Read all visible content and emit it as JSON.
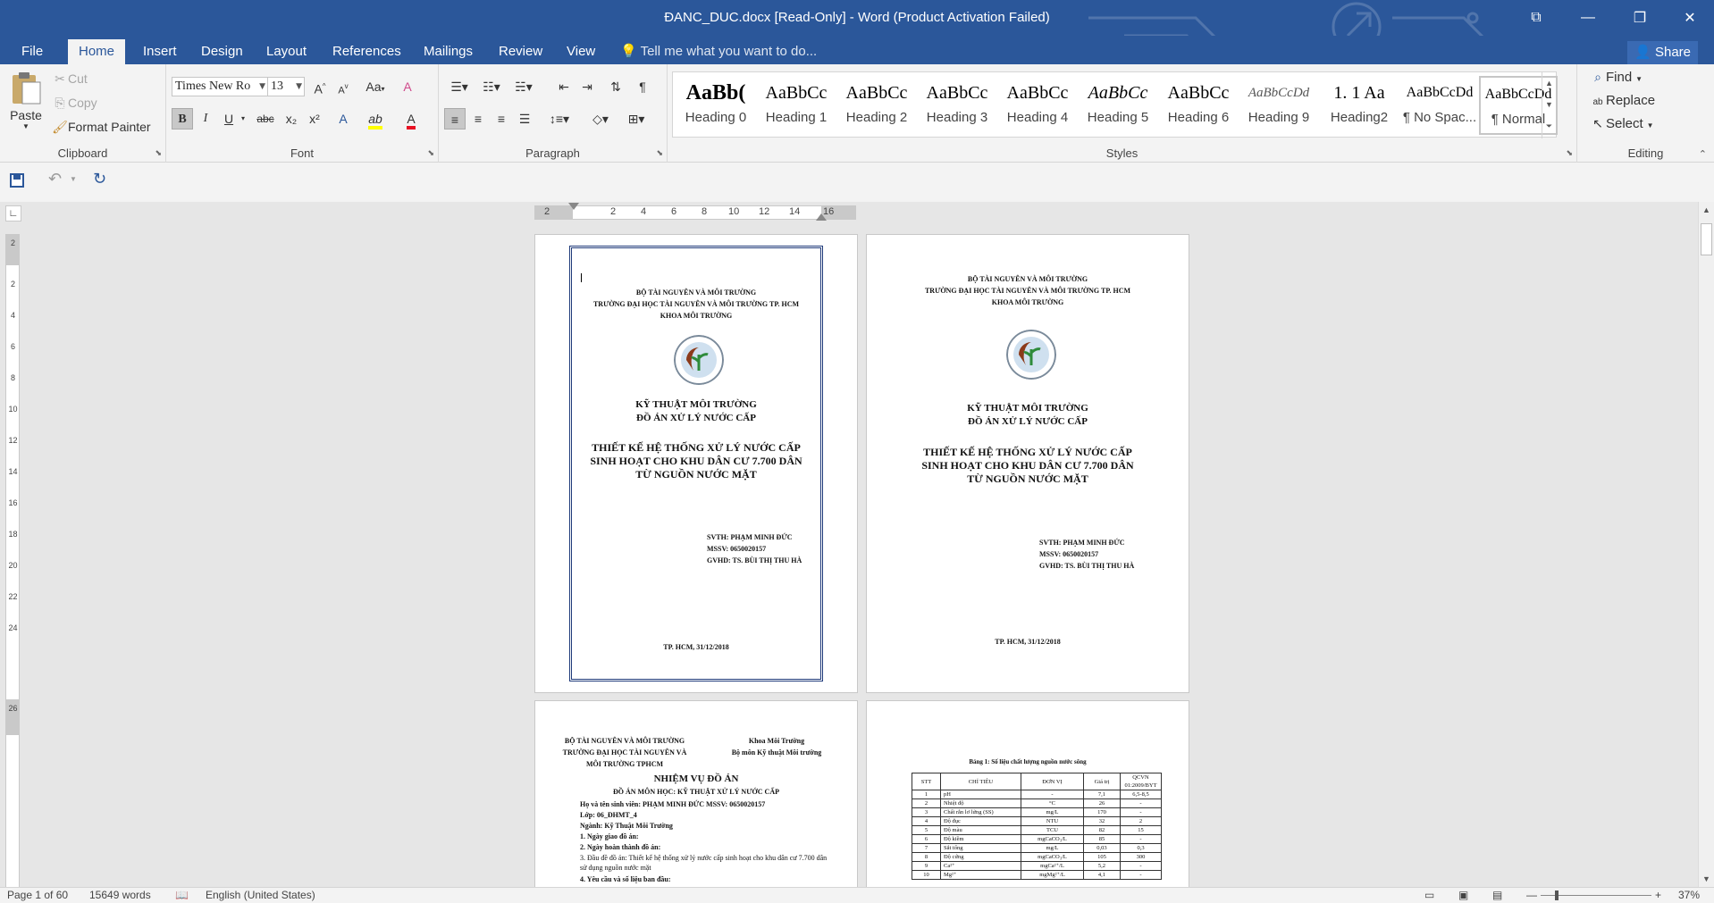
{
  "window": {
    "title": "ĐANC_DUC.docx [Read-Only] - Word (Product Activation Failed)",
    "controls": [
      "ribbon-display-icon",
      "minimize-icon",
      "restore-icon",
      "close-icon"
    ]
  },
  "tabs": {
    "file": "File",
    "items": [
      "Home",
      "Insert",
      "Design",
      "Layout",
      "References",
      "Mailings",
      "Review",
      "View"
    ],
    "active": "Home",
    "tell_me": "Tell me what you want to do...",
    "share": "Share"
  },
  "ribbon": {
    "clipboard": {
      "label": "Clipboard",
      "paste": "Paste",
      "cut": "Cut",
      "copy": "Copy",
      "format_painter": "Format Painter"
    },
    "font": {
      "label": "Font",
      "name": "Times New Ro",
      "size": "13",
      "bold": "B",
      "italic": "I",
      "underline": "U",
      "strike": "abc",
      "subscript": "x₂",
      "superscript": "x²",
      "grow": "A",
      "shrink": "A",
      "case": "Aa",
      "font_color": "A",
      "highlight": "ab"
    },
    "paragraph": {
      "label": "Paragraph"
    },
    "styles": {
      "label": "Styles",
      "items": [
        {
          "preview": "AaBb(",
          "name": "Heading 0"
        },
        {
          "preview": "AaBbCc",
          "name": "Heading 1"
        },
        {
          "preview": "AaBbCc",
          "name": "Heading 2"
        },
        {
          "preview": "AaBbCc",
          "name": "Heading 3"
        },
        {
          "preview": "AaBbCc",
          "name": "Heading 4"
        },
        {
          "preview": "AaBbCc",
          "name": "Heading 5"
        },
        {
          "preview": "AaBbCc",
          "name": "Heading 6"
        },
        {
          "preview": "AaBbCcDd",
          "name": "Heading 9"
        },
        {
          "preview": "1. 1  Aa",
          "name": "Heading2"
        },
        {
          "preview": "AaBbCcDd",
          "name": "¶ No Spac..."
        },
        {
          "preview": "AaBbCcDd",
          "name": "¶ Normal"
        }
      ],
      "selected": "¶ Normal"
    },
    "editing": {
      "label": "Editing",
      "find": "Find",
      "replace": "Replace",
      "select": "Select"
    }
  },
  "ruler": {
    "h_ticks": [
      "2",
      "2",
      "4",
      "6",
      "8",
      "10",
      "12",
      "14",
      "16"
    ],
    "v_ticks": [
      "2",
      "2",
      "4",
      "6",
      "8",
      "10",
      "12",
      "14",
      "16",
      "18",
      "20",
      "22",
      "24",
      "26"
    ]
  },
  "pages": {
    "cover": {
      "ministry": "BỘ TÀI NGUYÊN VÀ MÔI TRƯỜNG",
      "university": "TRƯỜNG ĐẠI HỌC TÀI NGUYÊN VÀ MÔI TRƯỜNG TP. HCM",
      "faculty": "KHOA MÔI TRƯỜNG",
      "subject": "KỸ THUẬT MÔI TRƯỜNG",
      "project": "ĐỒ ÁN XỬ LÝ NƯỚC CẤP",
      "title_1": "THIẾT KẾ HỆ THỐNG XỬ LÝ NƯỚC CẤP",
      "title_2": "SINH HOẠT CHO KHU DÂN CƯ 7.700 DÂN",
      "title_3": "TỪ NGUỒN NƯỚC MẶT",
      "student": "SVTH: PHẠM MINH ĐỨC",
      "mssv": "MSSV: 0650020157",
      "advisor": "GVHD: TS. BÙI THỊ THU HÀ",
      "place_date": "TP. HCM, 31/12/2018"
    },
    "task": {
      "left_1": "BỘ TÀI NGUYÊN VÀ MÔI TRƯỜNG",
      "left_2": "TRƯỜNG ĐẠI HỌC TÀI NGUYÊN VÀ",
      "left_3": "MÔI TRƯỜNG TPHCM",
      "right_1": "Khoa Môi Trường",
      "right_2": "Bộ môn Kỹ thuật Môi trường",
      "heading": "NHIỆM VỤ ĐỒ ÁN",
      "subheading": "ĐỒ ÁN MÔN HỌC: KỸ THUẬT XỬ LÝ NƯỚC CẤP",
      "lines": [
        "Họ và tên sinh viên: PHẠM MINH ĐỨC          MSSV: 0650020157",
        "Lớp: 06_ĐHMT_4",
        "Ngành: Kỹ Thuật Môi Trường",
        "1. Ngày giao đồ án:",
        "2. Ngày hoàn thành đồ án:",
        "3. Đầu đề đồ án: Thiết kế hệ thống xử lý nước cấp sinh hoạt cho khu dân cư 7.700 dân",
        "sử dụng nguồn nước mặt",
        "4. Yêu cầu và số liệu ban đầu:"
      ]
    },
    "table_page": {
      "caption": "Bảng 1: Số liệu chất lượng nguồn nước sông",
      "headers": [
        "STT",
        "CHỈ TIÊU",
        "ĐƠN VỊ",
        "Giá trị",
        "QCVN 01:2009/BYT"
      ],
      "rows": [
        [
          "1",
          "pH",
          "-",
          "7,1",
          "6,5-8,5"
        ],
        [
          "2",
          "Nhiệt độ",
          "°C",
          "26",
          "-"
        ],
        [
          "3",
          "Chất rắn lơ lửng (SS)",
          "mg/L",
          "170",
          "-"
        ],
        [
          "4",
          "Độ đục",
          "NTU",
          "32",
          "2"
        ],
        [
          "5",
          "Độ màu",
          "TCU",
          "82",
          "15"
        ],
        [
          "6",
          "Độ kiềm",
          "mgCaCO₃/L",
          "85",
          "-"
        ],
        [
          "7",
          "Sắt tổng",
          "mg/L",
          "0,03",
          "0,3"
        ],
        [
          "8",
          "Độ cứng",
          "mgCaCO₃/L",
          "105",
          "300"
        ],
        [
          "9",
          "Ca²⁺",
          "mgCa²⁺/L",
          "5,2",
          "-"
        ],
        [
          "10",
          "Mg²⁺",
          "mgMg²⁺/L",
          "4,1",
          "-"
        ]
      ]
    }
  },
  "status": {
    "page": "Page 1 of 60",
    "words": "15649 words",
    "language": "English (United States)",
    "zoom": "37%"
  }
}
